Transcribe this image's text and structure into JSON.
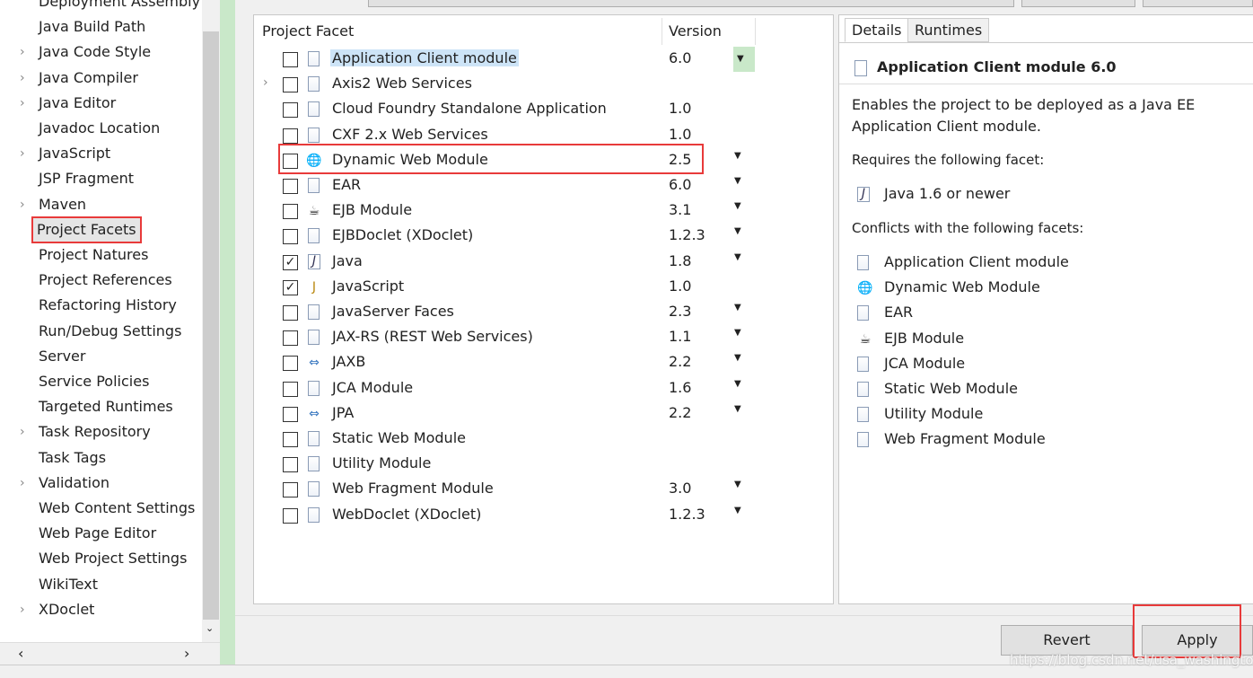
{
  "sidebar": {
    "items": [
      {
        "label": "Deployment Assembly",
        "chev": false
      },
      {
        "label": "Java Build Path",
        "chev": false
      },
      {
        "label": "Java Code Style",
        "chev": true
      },
      {
        "label": "Java Compiler",
        "chev": true
      },
      {
        "label": "Java Editor",
        "chev": true
      },
      {
        "label": "Javadoc Location",
        "chev": false
      },
      {
        "label": "JavaScript",
        "chev": true
      },
      {
        "label": "JSP Fragment",
        "chev": false
      },
      {
        "label": "Maven",
        "chev": true
      },
      {
        "label": "Project Facets",
        "chev": false,
        "selected": true
      },
      {
        "label": "Project Natures",
        "chev": false
      },
      {
        "label": "Project References",
        "chev": false
      },
      {
        "label": "Refactoring History",
        "chev": false
      },
      {
        "label": "Run/Debug Settings",
        "chev": false
      },
      {
        "label": "Server",
        "chev": false
      },
      {
        "label": "Service Policies",
        "chev": false
      },
      {
        "label": "Targeted Runtimes",
        "chev": false
      },
      {
        "label": "Task Repository",
        "chev": true
      },
      {
        "label": "Task Tags",
        "chev": false
      },
      {
        "label": "Validation",
        "chev": true
      },
      {
        "label": "Web Content Settings",
        "chev": false
      },
      {
        "label": "Web Page Editor",
        "chev": false
      },
      {
        "label": "Web Project Settings",
        "chev": false
      },
      {
        "label": "WikiText",
        "chev": false
      },
      {
        "label": "XDoclet",
        "chev": true
      }
    ]
  },
  "facets": {
    "col_facet": "Project Facet",
    "col_version": "Version",
    "rows": [
      {
        "name": "Application Client module",
        "version": "6.0",
        "dd": true,
        "checked": false,
        "icon": "page",
        "selected": true
      },
      {
        "name": "Axis2 Web Services",
        "version": "",
        "dd": false,
        "checked": false,
        "icon": "page",
        "chev": true
      },
      {
        "name": "Cloud Foundry Standalone Application",
        "version": "1.0",
        "dd": false,
        "checked": false,
        "icon": "page"
      },
      {
        "name": "CXF 2.x Web Services",
        "version": "1.0",
        "dd": false,
        "checked": false,
        "icon": "page"
      },
      {
        "name": "Dynamic Web Module",
        "version": "2.5",
        "dd": true,
        "checked": false,
        "icon": "globe",
        "highlight": true
      },
      {
        "name": "EAR",
        "version": "6.0",
        "dd": true,
        "checked": false,
        "icon": "page"
      },
      {
        "name": "EJB Module",
        "version": "3.1",
        "dd": true,
        "checked": false,
        "icon": "bean"
      },
      {
        "name": "EJBDoclet (XDoclet)",
        "version": "1.2.3",
        "dd": true,
        "checked": false,
        "icon": "page"
      },
      {
        "name": "Java",
        "version": "1.8",
        "dd": true,
        "checked": true,
        "icon": "java"
      },
      {
        "name": "JavaScript",
        "version": "1.0",
        "dd": false,
        "checked": true,
        "icon": "javascript"
      },
      {
        "name": "JavaServer Faces",
        "version": "2.3",
        "dd": true,
        "checked": false,
        "icon": "page"
      },
      {
        "name": "JAX-RS (REST Web Services)",
        "version": "1.1",
        "dd": true,
        "checked": false,
        "icon": "page"
      },
      {
        "name": "JAXB",
        "version": "2.2",
        "dd": true,
        "checked": false,
        "icon": "arrows"
      },
      {
        "name": "JCA Module",
        "version": "1.6",
        "dd": true,
        "checked": false,
        "icon": "page"
      },
      {
        "name": "JPA",
        "version": "2.2",
        "dd": true,
        "checked": false,
        "icon": "arrows"
      },
      {
        "name": "Static Web Module",
        "version": "",
        "dd": false,
        "checked": false,
        "icon": "page"
      },
      {
        "name": "Utility Module",
        "version": "",
        "dd": false,
        "checked": false,
        "icon": "page"
      },
      {
        "name": "Web Fragment Module",
        "version": "3.0",
        "dd": true,
        "checked": false,
        "icon": "page"
      },
      {
        "name": "WebDoclet (XDoclet)",
        "version": "1.2.3",
        "dd": true,
        "checked": false,
        "icon": "page"
      }
    ]
  },
  "details": {
    "tabs": [
      "Details",
      "Runtimes"
    ],
    "title": "Application Client module 6.0",
    "desc1": "Enables the project to be deployed as a Java EE",
    "desc2": "Application Client module.",
    "requires_label": "Requires the following facet:",
    "requires": [
      {
        "label": "Java 1.6 or newer",
        "icon": "java"
      }
    ],
    "conflicts_label": "Conflicts with the following facets:",
    "conflicts": [
      {
        "label": "Application Client module",
        "icon": "page"
      },
      {
        "label": "Dynamic Web Module",
        "icon": "globe"
      },
      {
        "label": "EAR",
        "icon": "page"
      },
      {
        "label": "EJB Module",
        "icon": "bean"
      },
      {
        "label": "JCA Module",
        "icon": "page"
      },
      {
        "label": "Static Web Module",
        "icon": "page"
      },
      {
        "label": "Utility Module",
        "icon": "page"
      },
      {
        "label": "Web Fragment Module",
        "icon": "page"
      }
    ]
  },
  "buttons": {
    "revert": "Revert",
    "apply": "Apply"
  },
  "watermark": "https://blog.csdn.net/usa_washington",
  "colors": {
    "highlight": "#e83a3a",
    "selection": "#cde4f7",
    "green_strip": "#c9e8c9"
  }
}
